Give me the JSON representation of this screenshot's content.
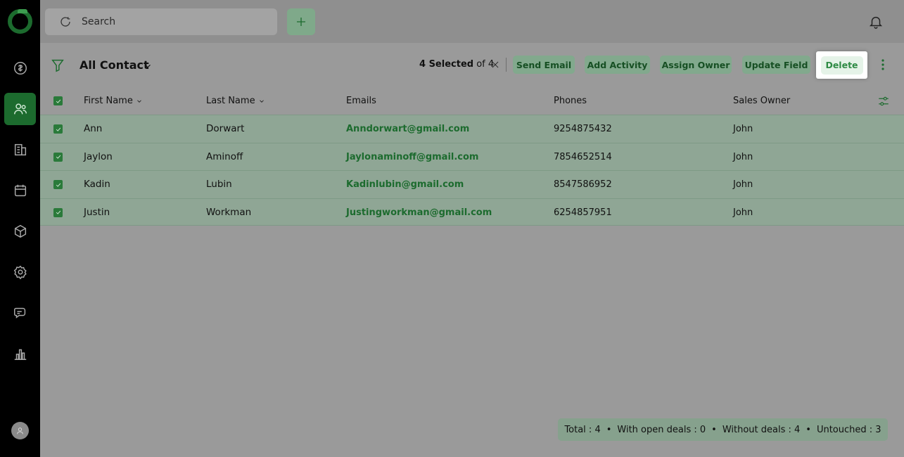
{
  "search": {
    "placeholder": "Search"
  },
  "view": {
    "title": "All Contact"
  },
  "selection": {
    "count_text": "4 Selected",
    "of_text": "of 4"
  },
  "actions": {
    "send_email": "Send Email",
    "add_activity": "Add Activity",
    "assign_owner": "Assign Owner",
    "update_field": "Update Field",
    "delete": "Delete"
  },
  "table": {
    "headers": {
      "first_name": "First Name",
      "last_name": "Last Name",
      "emails": "Emails",
      "phones": "Phones",
      "sales_owner": "Sales Owner"
    },
    "rows": [
      {
        "first": "Ann",
        "last": "Dorwart",
        "email": "Anndorwart@gmail.com",
        "phone": "9254875432",
        "owner": "John"
      },
      {
        "first": "Jaylon",
        "last": "Aminoff",
        "email": "Jaylonaminoff@gmail.com",
        "phone": "7854652514",
        "owner": "John"
      },
      {
        "first": "Kadin",
        "last": "Lubin",
        "email": "Kadinlubin@gmail.com",
        "phone": "8547586952",
        "owner": "John"
      },
      {
        "first": "Justin",
        "last": "Workman",
        "email": "Justingworkman@gmail.com",
        "phone": "6254857951",
        "owner": "John"
      }
    ]
  },
  "stats": {
    "total": "Total : 4",
    "open_deals": "With open deals : 0",
    "without_deals": "Without deals : 4",
    "untouched": "Untouched : 3"
  },
  "colors": {
    "accent": "#1c6b2e",
    "sidebar": "#000000",
    "row_selected": "#8fa695"
  },
  "icons": [
    "logo",
    "deals-icon",
    "contacts-icon",
    "companies-icon",
    "calendar-icon",
    "products-icon",
    "settings-icon",
    "chat-icon",
    "reports-icon",
    "user-avatar-icon",
    "search-icon",
    "plus-icon",
    "bell-icon",
    "filter-icon",
    "chevron-down-icon",
    "close-icon",
    "kebab-icon",
    "column-settings-icon"
  ]
}
